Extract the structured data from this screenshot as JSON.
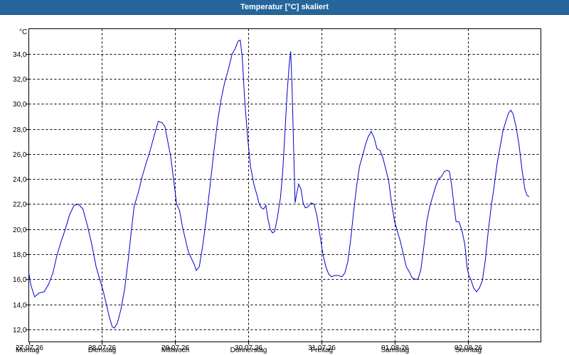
{
  "window": {
    "title": "Temperatur [°C] skaliert"
  },
  "colors": {
    "titlebar": "#24669b",
    "line": "#0000cc",
    "grid": "#000000"
  },
  "chart_data": {
    "type": "line",
    "title": "Temperatur [°C] skaliert",
    "ylabel": "°C",
    "xlabel": "",
    "ylim": [
      11.0,
      36.0
    ],
    "yticks": [
      12.0,
      14.0,
      16.0,
      18.0,
      20.0,
      22.0,
      24.0,
      26.0,
      28.0,
      30.0,
      32.0,
      34.0
    ],
    "ytick_labels": [
      "12,0",
      "14,0",
      "16,0",
      "18,0",
      "20,0",
      "22,0",
      "24,0",
      "26,0",
      "28,0",
      "30,0",
      "32,0",
      "34,0"
    ],
    "xlim": [
      0,
      7
    ],
    "xticks": [
      {
        "day": "Montag",
        "date": "27.07.26"
      },
      {
        "day": "Dienstag",
        "date": "28.07.26"
      },
      {
        "day": "Mittwoch",
        "date": "29.07.26"
      },
      {
        "day": "Donnerstag",
        "date": "30.07.26"
      },
      {
        "day": "Freitag",
        "date": "31.07.26"
      },
      {
        "day": "Samstag",
        "date": "01.08.26"
      },
      {
        "day": "Sonntag",
        "date": "02.08.26"
      }
    ],
    "grid": true,
    "grid_style": "dashed",
    "series": [
      {
        "values": [
          [
            0.0,
            16.5
          ],
          [
            0.03,
            15.5
          ],
          [
            0.08,
            14.6
          ],
          [
            0.14,
            14.9
          ],
          [
            0.21,
            15.0
          ],
          [
            0.27,
            15.6
          ],
          [
            0.33,
            16.5
          ],
          [
            0.38,
            17.8
          ],
          [
            0.44,
            19.0
          ],
          [
            0.5,
            20.0
          ],
          [
            0.56,
            21.2
          ],
          [
            0.62,
            21.9
          ],
          [
            0.68,
            22.0
          ],
          [
            0.74,
            21.6
          ],
          [
            0.8,
            20.3
          ],
          [
            0.86,
            18.8
          ],
          [
            0.92,
            17.0
          ],
          [
            0.98,
            15.8
          ],
          [
            1.02,
            15.0
          ],
          [
            1.06,
            14.0
          ],
          [
            1.1,
            13.0
          ],
          [
            1.14,
            12.2
          ],
          [
            1.17,
            12.1
          ],
          [
            1.21,
            12.5
          ],
          [
            1.26,
            13.6
          ],
          [
            1.31,
            15.2
          ],
          [
            1.36,
            17.6
          ],
          [
            1.4,
            19.8
          ],
          [
            1.44,
            21.8
          ],
          [
            1.5,
            23.0
          ],
          [
            1.55,
            24.2
          ],
          [
            1.6,
            25.2
          ],
          [
            1.66,
            26.3
          ],
          [
            1.72,
            27.6
          ],
          [
            1.77,
            28.6
          ],
          [
            1.82,
            28.5
          ],
          [
            1.86,
            28.2
          ],
          [
            1.9,
            27.0
          ],
          [
            1.94,
            25.8
          ],
          [
            1.98,
            23.9
          ],
          [
            2.02,
            22.0
          ],
          [
            2.06,
            21.5
          ],
          [
            2.1,
            20.2
          ],
          [
            2.14,
            19.2
          ],
          [
            2.18,
            18.2
          ],
          [
            2.22,
            17.7
          ],
          [
            2.26,
            17.2
          ],
          [
            2.29,
            16.7
          ],
          [
            2.33,
            17.0
          ],
          [
            2.38,
            18.8
          ],
          [
            2.43,
            21.0
          ],
          [
            2.48,
            23.6
          ],
          [
            2.53,
            26.2
          ],
          [
            2.58,
            28.6
          ],
          [
            2.63,
            30.4
          ],
          [
            2.68,
            31.8
          ],
          [
            2.73,
            32.8
          ],
          [
            2.78,
            34.0
          ],
          [
            2.82,
            34.4
          ],
          [
            2.86,
            35.0
          ],
          [
            2.89,
            35.1
          ],
          [
            2.92,
            33.6
          ],
          [
            2.95,
            30.4
          ],
          [
            2.99,
            27.4
          ],
          [
            3.03,
            25.0
          ],
          [
            3.08,
            23.5
          ],
          [
            3.12,
            22.7
          ],
          [
            3.15,
            22.0
          ],
          [
            3.18,
            21.7
          ],
          [
            3.21,
            21.6
          ],
          [
            3.24,
            21.9
          ],
          [
            3.27,
            20.8
          ],
          [
            3.3,
            20.0
          ],
          [
            3.33,
            19.7
          ],
          [
            3.36,
            19.8
          ],
          [
            3.4,
            21.0
          ],
          [
            3.44,
            22.5
          ],
          [
            3.47,
            24.5
          ],
          [
            3.5,
            27.6
          ],
          [
            3.53,
            30.8
          ],
          [
            3.56,
            33.2
          ],
          [
            3.58,
            34.2
          ],
          [
            3.6,
            31.0
          ],
          [
            3.62,
            26.5
          ],
          [
            3.64,
            22.1
          ],
          [
            3.66,
            22.8
          ],
          [
            3.69,
            23.6
          ],
          [
            3.72,
            23.2
          ],
          [
            3.75,
            22.1
          ],
          [
            3.78,
            21.7
          ],
          [
            3.82,
            21.8
          ],
          [
            3.86,
            22.1
          ],
          [
            3.9,
            22.0
          ],
          [
            3.94,
            21.0
          ],
          [
            3.98,
            19.5
          ],
          [
            4.02,
            18.0
          ],
          [
            4.06,
            17.0
          ],
          [
            4.1,
            16.4
          ],
          [
            4.14,
            16.2
          ],
          [
            4.18,
            16.3
          ],
          [
            4.23,
            16.3
          ],
          [
            4.28,
            16.2
          ],
          [
            4.32,
            16.5
          ],
          [
            4.36,
            17.4
          ],
          [
            4.4,
            19.2
          ],
          [
            4.44,
            21.4
          ],
          [
            4.48,
            23.4
          ],
          [
            4.52,
            25.0
          ],
          [
            4.56,
            25.8
          ],
          [
            4.6,
            26.7
          ],
          [
            4.64,
            27.4
          ],
          [
            4.68,
            27.8
          ],
          [
            4.72,
            27.3
          ],
          [
            4.76,
            26.4
          ],
          [
            4.8,
            26.3
          ],
          [
            4.84,
            25.7
          ],
          [
            4.88,
            24.8
          ],
          [
            4.92,
            23.8
          ],
          [
            4.96,
            22.0
          ],
          [
            5.0,
            20.6
          ],
          [
            5.04,
            19.8
          ],
          [
            5.08,
            19.0
          ],
          [
            5.12,
            18.0
          ],
          [
            5.16,
            17.0
          ],
          [
            5.2,
            16.6
          ],
          [
            5.24,
            16.1
          ],
          [
            5.28,
            16.0
          ],
          [
            5.32,
            16.0
          ],
          [
            5.36,
            16.8
          ],
          [
            5.4,
            18.6
          ],
          [
            5.44,
            20.6
          ],
          [
            5.48,
            21.8
          ],
          [
            5.52,
            22.6
          ],
          [
            5.56,
            23.4
          ],
          [
            5.6,
            24.0
          ],
          [
            5.64,
            24.2
          ],
          [
            5.68,
            24.6
          ],
          [
            5.72,
            24.7
          ],
          [
            5.75,
            24.6
          ],
          [
            5.78,
            23.5
          ],
          [
            5.81,
            22.0
          ],
          [
            5.84,
            20.6
          ],
          [
            5.88,
            20.6
          ],
          [
            5.92,
            19.9
          ],
          [
            5.96,
            18.8
          ],
          [
            5.99,
            17.0
          ],
          [
            6.01,
            16.4
          ],
          [
            6.04,
            16.0
          ],
          [
            6.08,
            15.3
          ],
          [
            6.12,
            15.0
          ],
          [
            6.16,
            15.3
          ],
          [
            6.2,
            15.9
          ],
          [
            6.24,
            17.5
          ],
          [
            6.28,
            19.8
          ],
          [
            6.32,
            21.8
          ],
          [
            6.36,
            23.4
          ],
          [
            6.4,
            25.2
          ],
          [
            6.44,
            26.5
          ],
          [
            6.48,
            27.8
          ],
          [
            6.52,
            28.6
          ],
          [
            6.56,
            29.3
          ],
          [
            6.59,
            29.5
          ],
          [
            6.62,
            29.2
          ],
          [
            6.66,
            28.2
          ],
          [
            6.7,
            26.8
          ],
          [
            6.74,
            24.8
          ],
          [
            6.78,
            23.2
          ],
          [
            6.81,
            22.7
          ],
          [
            6.84,
            22.6
          ]
        ]
      }
    ]
  }
}
